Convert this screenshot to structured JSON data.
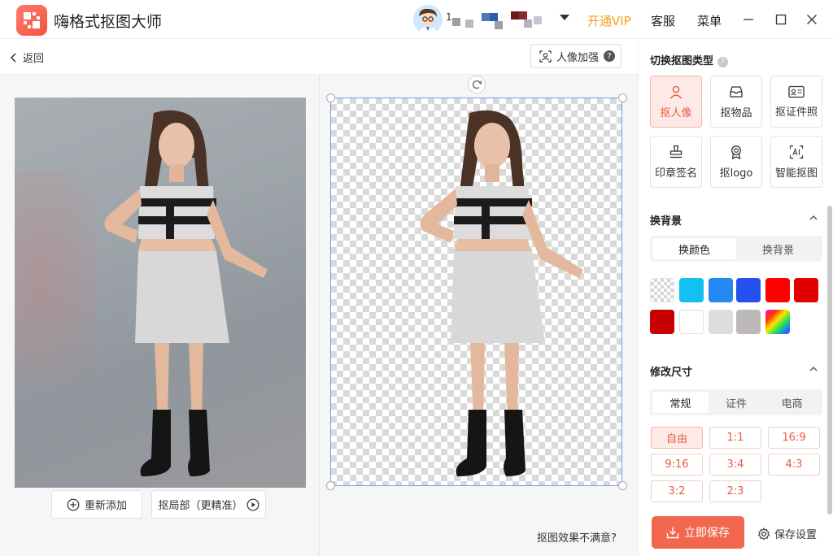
{
  "app": {
    "title": "嗨格式抠图大师"
  },
  "header": {
    "username_fragment": "1",
    "vip": "开通VIP",
    "service": "客服",
    "menu": "菜单"
  },
  "toolbar": {
    "back": "返回",
    "enhance": "人像加强",
    "enhance_help": "?"
  },
  "canvas": {
    "readd": "重新添加",
    "local": "抠局部（更精准）",
    "unsatisfied": "抠图效果不满意?"
  },
  "sidebar": {
    "cutout_type": {
      "title": "切换抠图类型",
      "help": "?",
      "items": [
        {
          "label": "抠人像",
          "icon": "person-icon",
          "active": true
        },
        {
          "label": "抠物品",
          "icon": "box-icon",
          "active": false
        },
        {
          "label": "抠证件照",
          "icon": "id-card-icon",
          "active": false
        },
        {
          "label": "印章签名",
          "icon": "stamp-icon",
          "active": false
        },
        {
          "label": "抠logo",
          "icon": "badge-icon",
          "active": false
        },
        {
          "label": "智能抠图",
          "icon": "ai-icon",
          "active": false
        }
      ]
    },
    "background": {
      "title": "换背景",
      "tabs": [
        {
          "label": "换颜色",
          "active": true
        },
        {
          "label": "换背景",
          "active": false
        }
      ],
      "colors": [
        "transparent",
        "#12c0f2",
        "#2388f2",
        "#2452f0",
        "#ff0000",
        "#e00000",
        "#c80000",
        "#ffffff",
        "#dddddd",
        "#bdb9b9",
        "gradient"
      ]
    },
    "size": {
      "title": "修改尺寸",
      "tabs": [
        {
          "label": "常规",
          "active": true
        },
        {
          "label": "证件",
          "active": false
        },
        {
          "label": "电商",
          "active": false
        }
      ],
      "ratios": [
        {
          "label": "自由",
          "active": true
        },
        {
          "label": "1:1",
          "active": false
        },
        {
          "label": "16:9",
          "active": false
        },
        {
          "label": "9:16",
          "active": false
        },
        {
          "label": "3:4",
          "active": false
        },
        {
          "label": "4:3",
          "active": false
        },
        {
          "label": "3:2",
          "active": false
        },
        {
          "label": "2:3",
          "active": false
        }
      ]
    },
    "save": "立即保存",
    "save_settings": "保存设置"
  },
  "colors": {
    "accent": "#f2674f",
    "vip": "#f2a11c",
    "selection": "#6ea0f0"
  }
}
